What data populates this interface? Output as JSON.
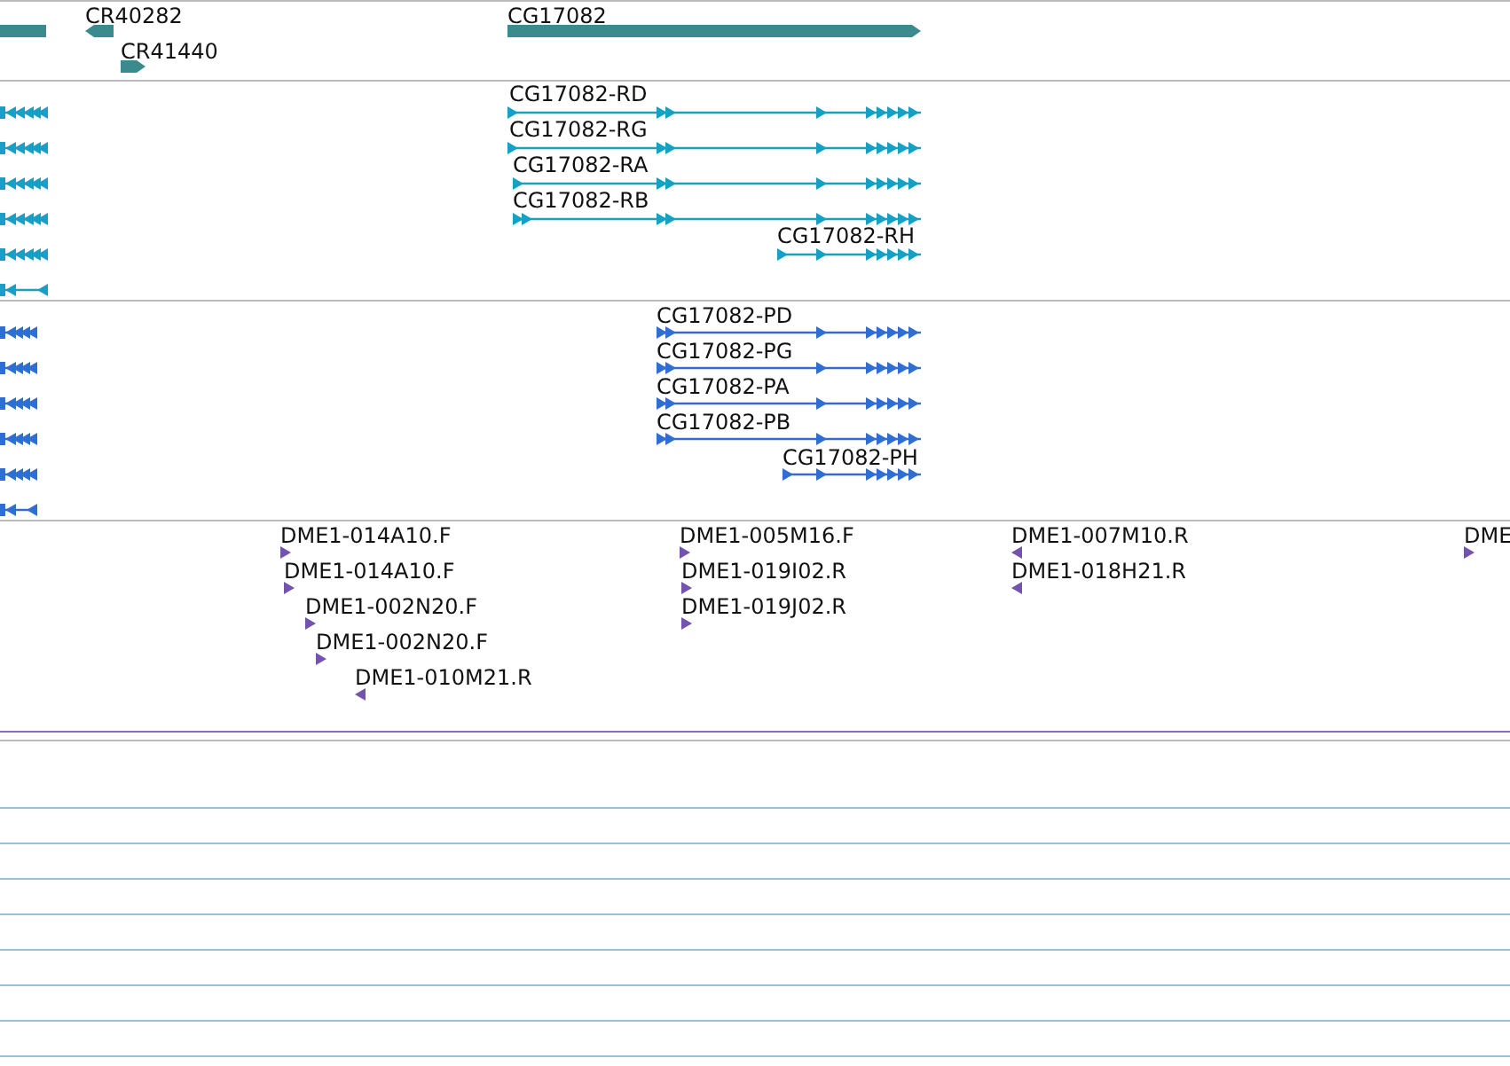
{
  "gene_track": {
    "features": [
      {
        "label": "CR40282",
        "reverse": true
      },
      {
        "label": "CR41440",
        "reverse": false
      },
      {
        "label": "CG17082",
        "reverse": false
      }
    ]
  },
  "transcript_track": {
    "features": [
      {
        "label": "CG17082-RD",
        "reverse": false
      },
      {
        "label": "CG17082-RG",
        "reverse": false
      },
      {
        "label": "CG17082-RA",
        "reverse": false
      },
      {
        "label": "CG17082-RB",
        "reverse": false
      },
      {
        "label": "CG17082-RH",
        "reverse": false
      }
    ]
  },
  "protein_track": {
    "features": [
      {
        "label": "CG17082-PD",
        "reverse": false
      },
      {
        "label": "CG17082-PG",
        "reverse": false
      },
      {
        "label": "CG17082-PA",
        "reverse": false
      },
      {
        "label": "CG17082-PB",
        "reverse": false
      },
      {
        "label": "CG17082-PH",
        "reverse": false
      }
    ]
  },
  "clone_track": {
    "features": [
      {
        "label": "DME1-014A10.F",
        "reverse": false
      },
      {
        "label": "DME1-014A10.F",
        "reverse": false
      },
      {
        "label": "DME1-002N20.F",
        "reverse": false
      },
      {
        "label": "DME1-002N20.F",
        "reverse": false
      },
      {
        "label": "DME1-010M21.R",
        "reverse": true
      },
      {
        "label": "DME1-005M16.F",
        "reverse": false
      },
      {
        "label": "DME1-019I02.R",
        "reverse": false
      },
      {
        "label": "DME1-019J02.R",
        "reverse": false
      },
      {
        "label": "DME1-007M10.R",
        "reverse": true
      },
      {
        "label": "DME1-018H21.R",
        "reverse": true
      },
      {
        "label": "DME",
        "reverse": false
      }
    ]
  }
}
